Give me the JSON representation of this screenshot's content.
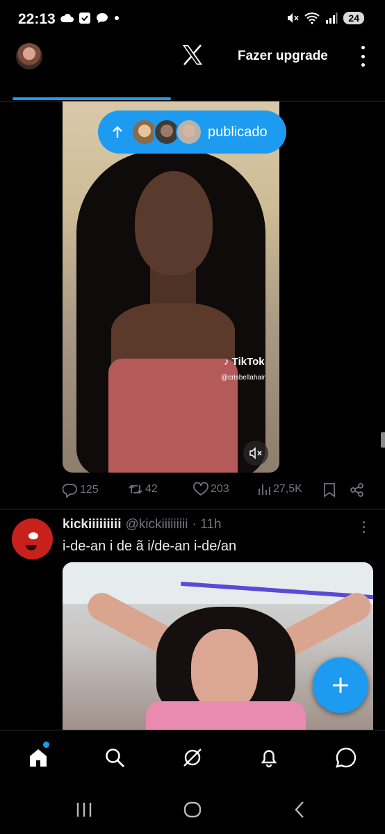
{
  "status_bar": {
    "time": "22:13",
    "battery": "24"
  },
  "top_bar": {
    "upgrade_label": "Fazer upgrade"
  },
  "post1": {
    "pill_label": "publicado",
    "tiktok_brand": "TikTok",
    "tiktok_handle": "@crisbellahair",
    "replies": "125",
    "reposts": "42",
    "likes": "203",
    "views": "27,5K"
  },
  "post2": {
    "name": "kickiiiiiiiii",
    "handle": "@kickiiiiiiiii",
    "time": "· 11h",
    "text": "i-de-an i de ã i/de-an i-de/an"
  },
  "colors": {
    "accent": "#1d9bf0",
    "muted": "#71767b",
    "background": "#000000"
  }
}
